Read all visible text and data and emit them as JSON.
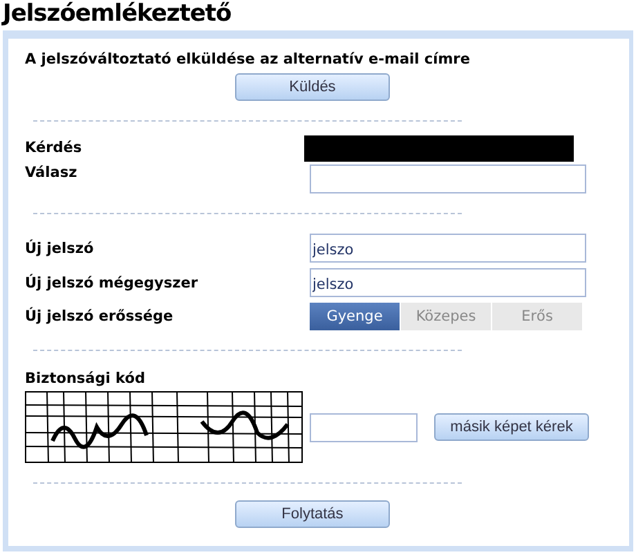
{
  "title": "Jelszóemlékeztető",
  "send_section": {
    "text": "A jelszóváltoztató elküldése az alternatív e-mail címre",
    "button": "Küldés"
  },
  "question": {
    "label": "Kérdés",
    "value_redacted": true
  },
  "answer": {
    "label": "Válasz"
  },
  "new_password": {
    "label": "Új jelszó",
    "value": "jelszo"
  },
  "new_password_again": {
    "label": "Új jelszó mégegyszer",
    "value": "jelszo"
  },
  "strength": {
    "label": "Új jelszó erőssége",
    "levels": [
      {
        "label": "Gyenge",
        "selected": true
      },
      {
        "label": "Közepes",
        "selected": false
      },
      {
        "label": "Erős",
        "selected": false
      }
    ]
  },
  "captcha": {
    "label": "Biztonsági kód",
    "button": "másik képet kérek"
  },
  "submit_button": "Folytatás"
}
